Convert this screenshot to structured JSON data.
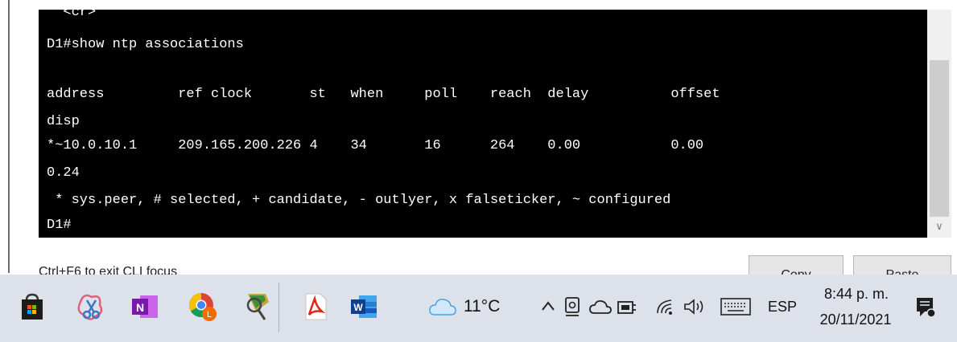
{
  "terminal": {
    "lines": [
      "  <cr>",
      "D1#show ntp associations",
      "",
      "address         ref clock       st   when     poll    reach  delay          offset",
      "disp",
      "*~10.0.10.1     209.165.200.226 4    34       16      264    0.00           0.00",
      "0.24",
      " * sys.peer, # selected, + candidate, - outlyer, x falseticker, ~ configured",
      "D1#"
    ]
  },
  "cli": {
    "hint": "Ctrl+F6 to exit CLI focus",
    "copy_label": "Copy",
    "paste_label": "Paste"
  },
  "taskbar": {
    "apps": [
      {
        "name": "store-icon"
      },
      {
        "name": "snipping-tool-icon"
      },
      {
        "name": "onenote-icon"
      },
      {
        "name": "chrome-icon"
      },
      {
        "name": "network-tool-icon"
      },
      {
        "name": "acrobat-icon"
      },
      {
        "name": "word-icon"
      }
    ],
    "weather": "11°C",
    "language": "ESP",
    "time": "8:44 p. m.",
    "date": "20/11/2021"
  },
  "colors": {
    "terminal_bg": "#000000",
    "terminal_fg": "#ffffff",
    "taskbar_bg": "#dde2ea"
  }
}
